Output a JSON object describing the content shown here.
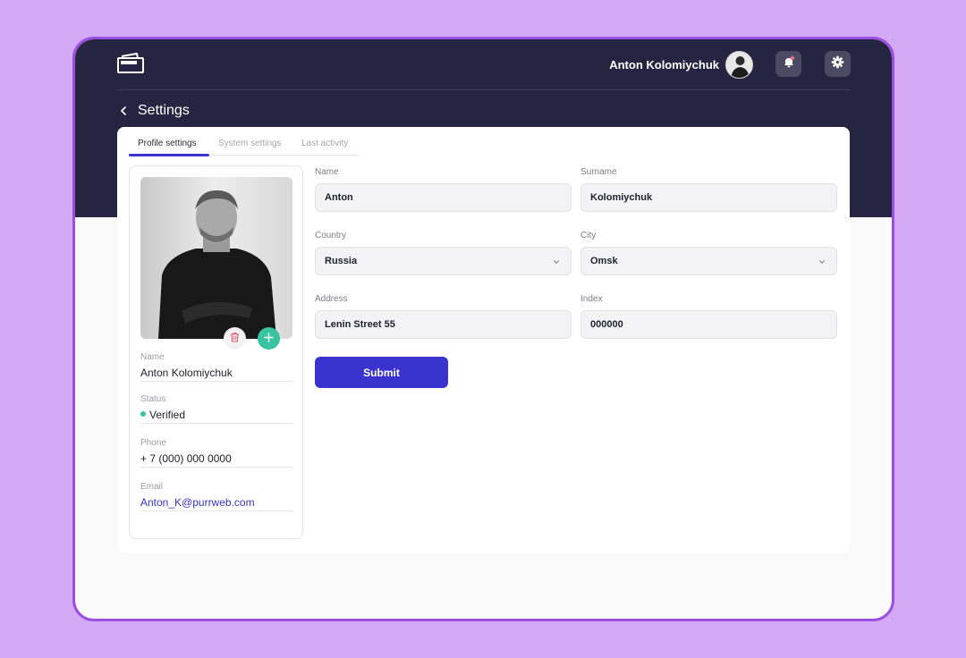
{
  "header": {
    "user_name": "Anton Kolomiychuk"
  },
  "page": {
    "title": "Settings"
  },
  "tabs": [
    {
      "label": "Profile settings",
      "active": true
    },
    {
      "label": "System settings",
      "active": false
    },
    {
      "label": "Last activity",
      "active": false
    }
  ],
  "profile": {
    "name_label": "Name",
    "name_value": "Anton Kolomiychuk",
    "status_label": "Status",
    "status_value": "Verified",
    "phone_label": "Phone",
    "phone_value": "+ 7 (000) 000 0000",
    "email_label": "Email",
    "email_value": "Anton_K@purrweb.com"
  },
  "form": {
    "name_label": "Name",
    "name_value": "Anton",
    "surname_label": "Surname",
    "surname_value": "Kolomiychuk",
    "country_label": "Country",
    "country_value": "Russia",
    "city_label": "City",
    "city_value": "Omsk",
    "address_label": "Address",
    "address_value": "Lenin Street 55",
    "index_label": "Index",
    "index_value": "000000",
    "submit_label": "Submit"
  },
  "colors": {
    "background": "#d3a8f5",
    "frame": "#9b4fe0",
    "header": "#252541",
    "accent": "#3a33d0",
    "success": "#39c3a0",
    "notification": "#f06a8a"
  }
}
